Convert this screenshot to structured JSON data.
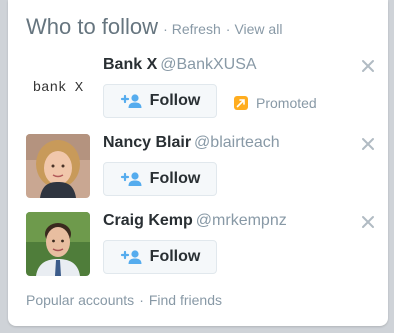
{
  "header": {
    "title": "Who to follow",
    "refresh_label": "Refresh",
    "view_all_label": "View all",
    "separator": "·"
  },
  "suggestions": [
    {
      "name": "Bank X",
      "handle": "@BankXUSA",
      "avatar_text": "bank X",
      "follow_label": "Follow",
      "promoted_label": "Promoted"
    },
    {
      "name": "Nancy Blair",
      "handle": "@blairteach",
      "follow_label": "Follow"
    },
    {
      "name": "Craig Kemp",
      "handle": "@mrkempnz",
      "follow_label": "Follow"
    }
  ],
  "footer": {
    "popular_label": "Popular accounts",
    "find_friends_label": "Find friends",
    "separator": "·"
  },
  "colors": {
    "accent": "#55acee",
    "muted": "#8899a6",
    "text": "#292f33",
    "promoted": "#ffad1f"
  },
  "icons": [
    "close-icon",
    "add-user-icon",
    "promoted-icon"
  ]
}
